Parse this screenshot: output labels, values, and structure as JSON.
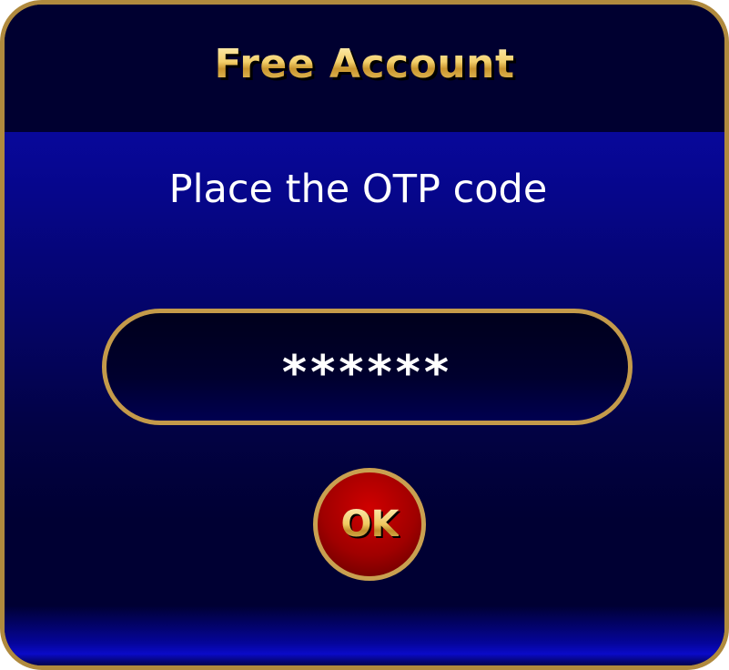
{
  "dialog": {
    "title": "Free Account",
    "prompt": "Place the OTP code",
    "otp_field": {
      "value": "******"
    },
    "ok_button": {
      "label": "OK"
    }
  },
  "colors": {
    "frame_gold": "#b08a3e",
    "header_bg": "#000030",
    "body_top_blue": "#08089a",
    "body_dark_blue": "#000033",
    "ok_button_red": "#a00000",
    "text_white": "#ffffff",
    "title_gold": "#f2d27a"
  }
}
